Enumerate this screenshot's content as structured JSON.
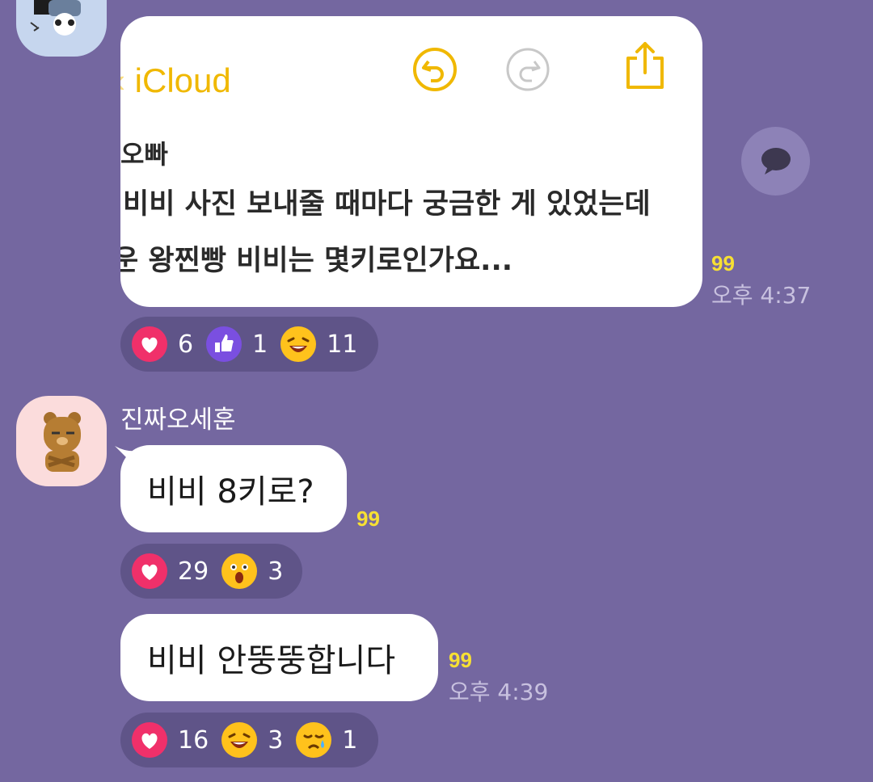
{
  "messages": {
    "first": {
      "image": {
        "icloud_label": "iCloud",
        "note_line1": "오빠",
        "note_line2": "비비 사진 보내줄 때마다 궁금한 게 있었는데",
        "note_line3": "운 왕찐빵 비비는 몇키로인가요..."
      },
      "unread": "99",
      "time": "오후 4:37",
      "reactions": [
        {
          "icon": "heart-icon",
          "count": "6"
        },
        {
          "icon": "thumbs-up-icon",
          "count": "1"
        },
        {
          "icon": "laughing-face-icon",
          "count": "11"
        }
      ]
    },
    "second": {
      "sender": "진짜오세훈",
      "text": "비비 8키로?",
      "unread": "99",
      "reactions": [
        {
          "icon": "heart-icon",
          "count": "29"
        },
        {
          "icon": "surprised-face-icon",
          "count": "3"
        }
      ]
    },
    "third": {
      "text": "비비 안뚱뚱합니다",
      "unread": "99",
      "time": "오후 4:39",
      "reactions": [
        {
          "icon": "heart-icon",
          "count": "16"
        },
        {
          "icon": "laughing-face-icon",
          "count": "3"
        },
        {
          "icon": "crying-face-icon",
          "count": "1"
        }
      ]
    }
  },
  "colors": {
    "background": "#7467a0",
    "reaction_pill": "#5f5488",
    "unread": "#f7e033",
    "heart": "#f0306a",
    "thumbs": "#7a4fe0",
    "emoji": "#ffc21c"
  }
}
